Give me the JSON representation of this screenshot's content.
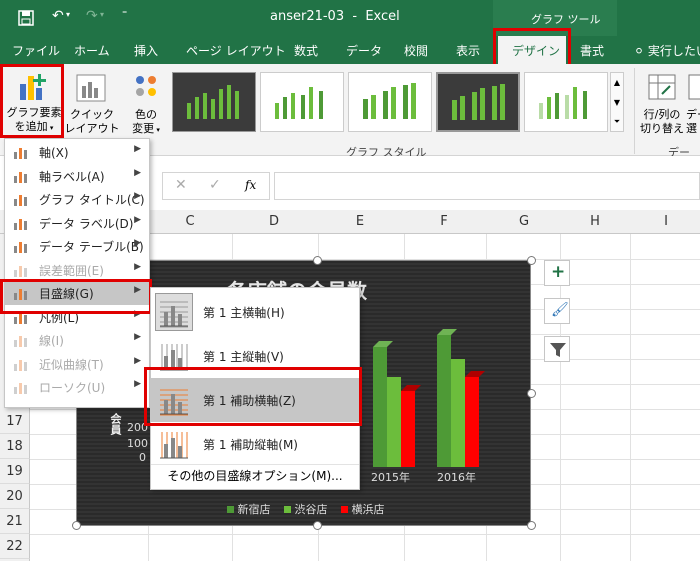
{
  "titlebar": {
    "filename": "anser21-03",
    "separator": "-",
    "app": "Excel",
    "context_label": "グラフ ツール"
  },
  "tabs": [
    "ファイル",
    "ホーム",
    "挿入",
    "ページ レイアウト",
    "数式",
    "データ",
    "校閲",
    "表示",
    "デザイン",
    "書式",
    "実行したい"
  ],
  "ribbon": {
    "add_element": [
      "グラフ要素",
      "を追加"
    ],
    "quick_layout": [
      "クイック",
      "レイアウト"
    ],
    "change_color": [
      "色の",
      "変更"
    ],
    "style_group_label": "グラフ スタイル",
    "row_col": [
      "行/列の",
      "切り替え"
    ],
    "data_label_partial": [
      "デー",
      "選"
    ],
    "data_group_label": "データ"
  },
  "formula": {
    "fx": "fx"
  },
  "columns": [
    "C",
    "D",
    "E",
    "F",
    "G",
    "H",
    "I"
  ],
  "rows": [
    "17",
    "18",
    "19",
    "20",
    "21",
    "22"
  ],
  "chart": {
    "title": "各店舗の会員数",
    "ylabel": "会員",
    "y_ticks": [
      "200",
      "100",
      "0"
    ],
    "x_labels": [
      "2015年",
      "2016年"
    ],
    "legend": [
      "新宿店",
      "渋谷店",
      "横浜店"
    ],
    "colors": {
      "shinjuku": "#4e9a36",
      "shibuya": "#6cbd3c",
      "yokohama": "#ff0000"
    }
  },
  "menu": {
    "items": [
      {
        "label": "軸(X)",
        "icon": "axis-icon",
        "arrow": true,
        "disabled": false
      },
      {
        "label": "軸ラベル(A)",
        "icon": "axis-label-icon",
        "arrow": true,
        "disabled": false
      },
      {
        "label": "グラフ タイトル(C)",
        "icon": "chart-title-icon",
        "arrow": true,
        "disabled": false
      },
      {
        "label": "データ ラベル(D)",
        "icon": "data-label-icon",
        "arrow": true,
        "disabled": false
      },
      {
        "label": "データ テーブル(B)",
        "icon": "data-table-icon",
        "arrow": true,
        "disabled": false
      },
      {
        "label": "誤差範囲(E)",
        "icon": "error-bars-icon",
        "arrow": true,
        "disabled": true
      },
      {
        "label": "目盛線(G)",
        "icon": "gridlines-icon",
        "arrow": true,
        "disabled": false
      },
      {
        "label": "凡例(L)",
        "icon": "legend-icon",
        "arrow": true,
        "disabled": false
      },
      {
        "label": "線(I)",
        "icon": "lines-icon",
        "arrow": true,
        "disabled": true
      },
      {
        "label": "近似曲線(T)",
        "icon": "trendline-icon",
        "arrow": true,
        "disabled": true
      },
      {
        "label": "ローソク(U)",
        "icon": "up-down-bars-icon",
        "arrow": true,
        "disabled": true
      }
    ]
  },
  "submenu": {
    "items": [
      {
        "label": "第 1 主横軸(H)"
      },
      {
        "label": "第 1 主縦軸(V)"
      },
      {
        "label": "第 1 補助横軸(Z)"
      },
      {
        "label": "第 1 補助縦軸(M)"
      }
    ],
    "more": "その他の目盛線オプション(M)..."
  }
}
